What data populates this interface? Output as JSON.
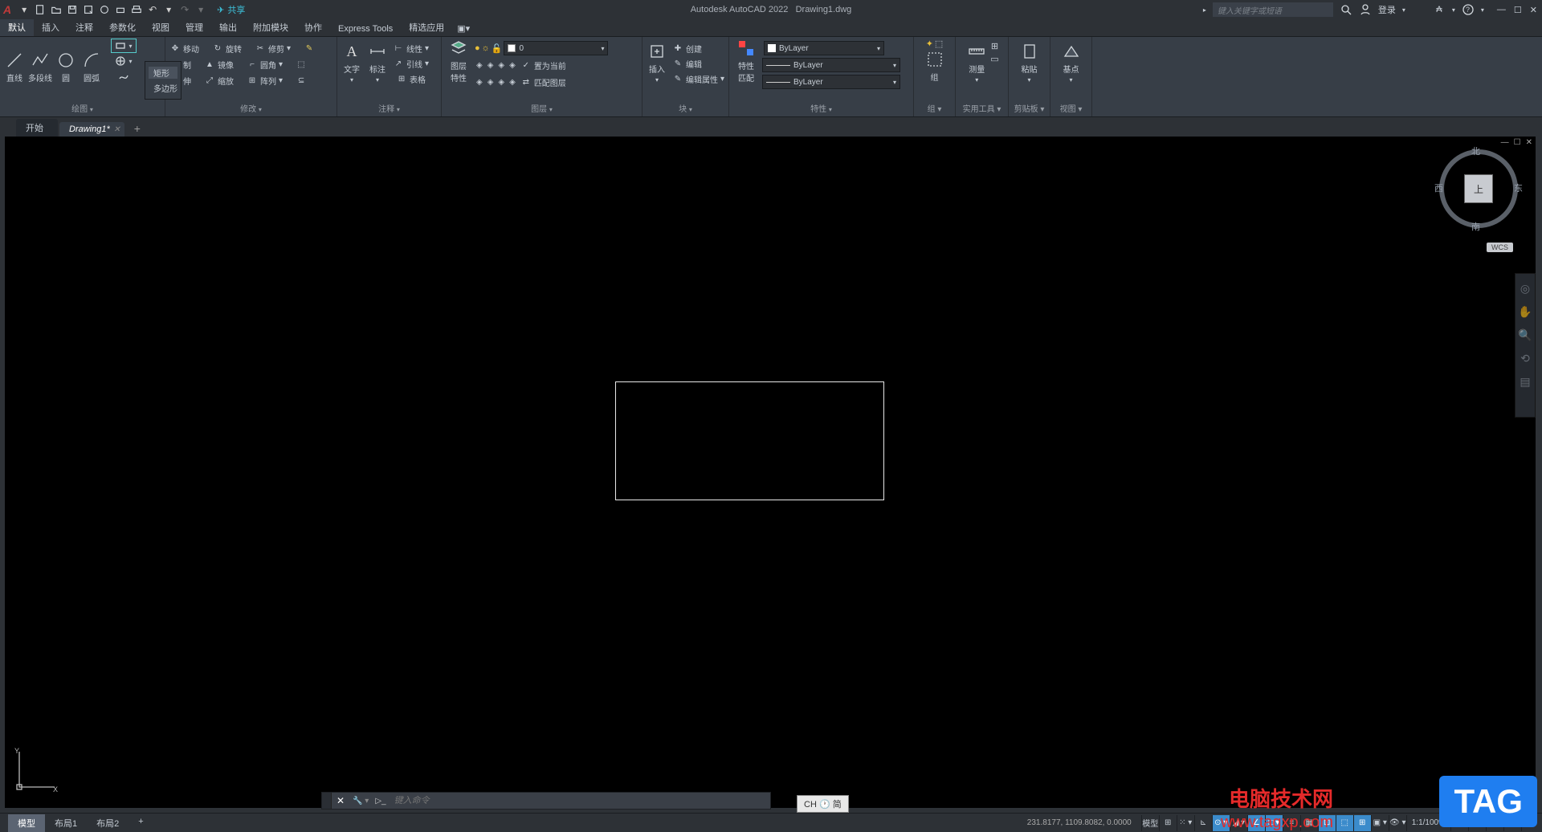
{
  "title_app": "Autodesk AutoCAD 2022",
  "title_file": "Drawing1.dwg",
  "share_label": "共享",
  "search_placeholder": "键入关键字或短语",
  "login_label": "登录",
  "menus": [
    "默认",
    "插入",
    "注释",
    "参数化",
    "视图",
    "管理",
    "输出",
    "附加模块",
    "协作",
    "Express Tools",
    "精选应用"
  ],
  "draw": {
    "line": "直线",
    "pline": "多段线",
    "circle": "圆",
    "arc": "圆弧",
    "rect": "矩形",
    "polygon": "多边形",
    "panel": "绘图"
  },
  "modify": {
    "move": "移动",
    "rotate": "旋转",
    "trim": "修剪",
    "copy": "制",
    "mirror": "镜像",
    "fillet": "圆角",
    "stretch": "伸",
    "scale": "缩放",
    "array": "阵列",
    "panel": "修改"
  },
  "annot": {
    "text": "文字",
    "dim": "标注",
    "linear": "线性",
    "leader": "引线",
    "table": "表格",
    "panel": "注释"
  },
  "layers": {
    "props": "图层\n特性",
    "cur": "ByLayer",
    "set": "置为当前",
    "match": "匹配图层",
    "panel": "图层",
    "zero": "0"
  },
  "block": {
    "insert": "插入",
    "create": "创建",
    "edit": "编辑",
    "attedit": "编辑属性",
    "panel": "块"
  },
  "prop": {
    "match": "特性\n匹配",
    "bylayer": "ByLayer",
    "panel": "特性"
  },
  "group": {
    "label": "组",
    "panel": "组"
  },
  "util": {
    "measure": "测量",
    "panel": "实用工具"
  },
  "clip": {
    "paste": "粘贴",
    "panel": "剪贴板"
  },
  "view": {
    "base": "基点",
    "panel": "视图"
  },
  "doctabs": {
    "start": "开始",
    "d1": "Drawing1*"
  },
  "viewcube": {
    "n": "北",
    "s": "南",
    "e": "东",
    "w": "西",
    "top": "上",
    "wcs": "WCS"
  },
  "cmd_placeholder": "键入命令",
  "coords": "231.8177, 1109.8082, 0.0000",
  "model": "模型",
  "layout": {
    "model": "模型",
    "l1": "布局1",
    "l2": "布局2"
  },
  "ime": "CH 🕐 简",
  "zoom": "1:1/100%",
  "watermark_title": "电脑技术网",
  "watermark_url": "www.tagxp.com",
  "tag_badge": "TAG",
  "tooltip": {
    "rect": "矩形",
    "polygon": "多边形"
  }
}
